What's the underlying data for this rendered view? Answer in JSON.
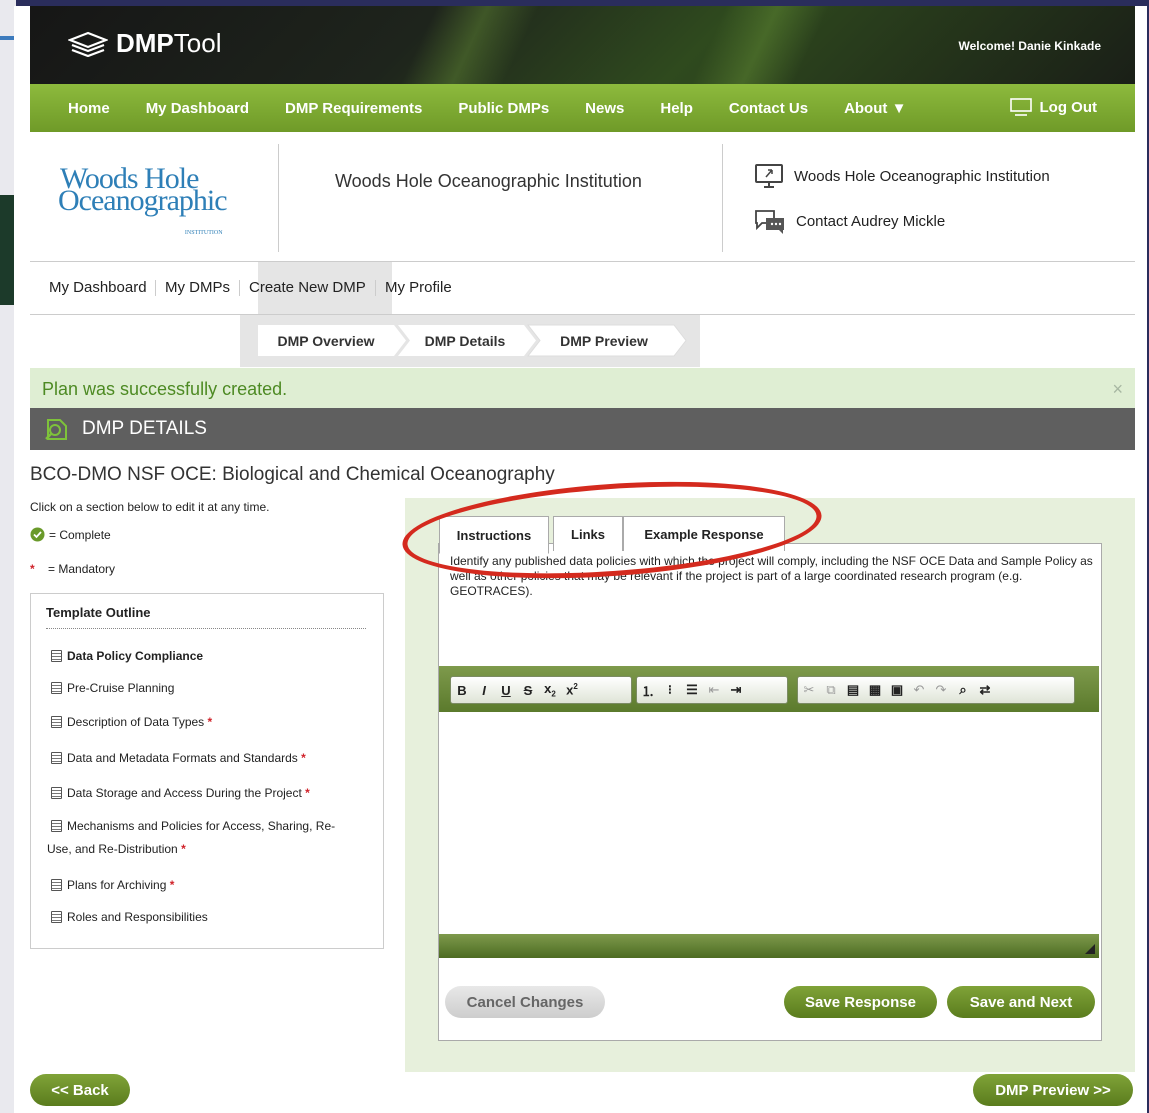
{
  "brand": {
    "name_bold": "DMP",
    "name_light": "Tool"
  },
  "welcome": {
    "prefix": "Welcome! ",
    "user": "Danie Kinkade"
  },
  "nav": {
    "items": [
      "Home",
      "My Dashboard",
      "DMP Requirements",
      "Public DMPs",
      "News",
      "Help",
      "Contact Us",
      "About"
    ],
    "logout": "Log Out"
  },
  "institution": {
    "logo_line1": "Woods Hole",
    "logo_line2": "Oceanographic",
    "logo_line3": "INSTITUTION",
    "title": "Woods Hole Oceanographic Institution",
    "links": [
      "Woods Hole Oceanographic Institution",
      "Contact Audrey Mickle"
    ]
  },
  "subnav": [
    "My Dashboard",
    "My DMPs",
    "Create New DMP",
    "My Profile"
  ],
  "steps": [
    "DMP Overview",
    "DMP Details",
    "DMP Preview"
  ],
  "alert": {
    "message": "Plan was successfully created.",
    "close": "×"
  },
  "section": {
    "title": "DMP DETAILS"
  },
  "plan": {
    "title": "BCO-DMO NSF OCE: Biological and Chemical Oceanography",
    "help": "Click on a section below to edit it at any time.",
    "legend_complete": "= Complete",
    "legend_mandatory_star": "*",
    "legend_mandatory": "= Mandatory"
  },
  "outline": {
    "header": "Template Outline",
    "items": [
      "Data Policy Compliance",
      "Pre-Cruise Planning",
      "Description of Data Types",
      "Data and Metadata Formats and Standards",
      "Data Storage and Access During the Project",
      "Mechanisms and Policies for Access, Sharing, Re-",
      "Use, and Re-Distribution",
      "Plans for Archiving",
      "Roles and Responsibilities"
    ],
    "star": "*"
  },
  "tabs": [
    "Instructions",
    "Links",
    "Example Response"
  ],
  "instructions": "Identify any published data policies with which the project will comply, including the NSF OCE Data and Sample Policy as well as other policies that may be relevant if the project is part of a large coordinated research program (e.g. GEOTRACES).",
  "buttons": {
    "cancel": "Cancel Changes",
    "save": "Save Response",
    "save_next": "Save and Next",
    "back": "<< Back",
    "preview": "DMP Preview >>"
  },
  "colors": {
    "nav_green": "#7aa530",
    "alert_bg": "#dfeed3",
    "alert_text": "#4d8a23",
    "section_bar": "#5f5f5f",
    "mandatory_red": "#d0232a",
    "highlight_red": "#d42a1e"
  },
  "icons": [
    "dmptool-logo-icon",
    "chevron-down-icon",
    "monitor-icon",
    "chat-icon",
    "search-icon",
    "check-circle-icon",
    "document-icon"
  ]
}
